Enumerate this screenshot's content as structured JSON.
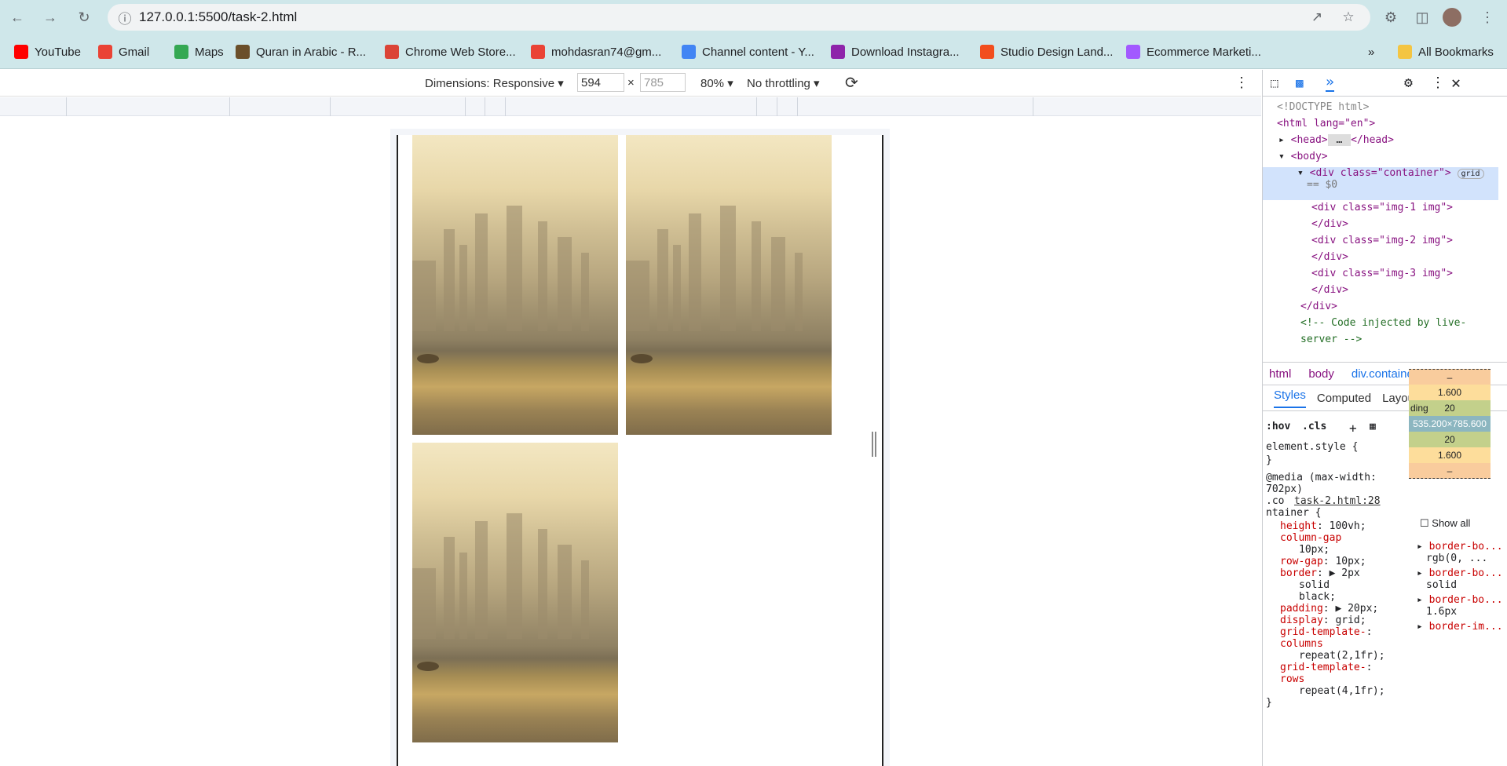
{
  "browser": {
    "url": "127.0.0.1:5500/task-2.html"
  },
  "bookmarks": [
    {
      "label": "YouTube",
      "icon": "youtube-icon",
      "color": "#ff0000"
    },
    {
      "label": "Gmail",
      "icon": "gmail-icon",
      "color": "#ea4335"
    },
    {
      "label": "Maps",
      "icon": "maps-icon",
      "color": "#34a853"
    },
    {
      "label": "Quran in Arabic - R...",
      "icon": "quran-icon",
      "color": "#6b4f2a"
    },
    {
      "label": "Chrome Web Store...",
      "icon": "chrome-store-icon",
      "color": "#db4437"
    },
    {
      "label": "mohdasran74@gm...",
      "icon": "gmail-icon",
      "color": "#ea4335"
    },
    {
      "label": "Channel content - Y...",
      "icon": "google-icon",
      "color": "#4285f4"
    },
    {
      "label": "Download Instagra...",
      "icon": "download-icon",
      "color": "#8e24aa"
    },
    {
      "label": "Studio Design Land...",
      "icon": "figma-icon",
      "color": "#f24e1e"
    },
    {
      "label": "Ecommerce Marketi...",
      "icon": "figma-icon",
      "color": "#a259ff"
    }
  ],
  "all_bookmarks": "All Bookmarks",
  "more_bookmarks": "»",
  "device_toolbar": {
    "dimensions_label": "Dimensions: Responsive",
    "width": "594",
    "times": "×",
    "height": "785",
    "zoom": "80%",
    "throttling": "No throttling"
  },
  "elements": {
    "doctype": "<!DOCTYPE html>",
    "html_open": "<html lang=\"en\">",
    "head": "<head>",
    "head_close": "</head>",
    "body": "<body>",
    "container": "<div class=\"container\">",
    "grid_badge": "grid",
    "dollar_zero": "== $0",
    "img1": "<div class=\"img-1 img\">",
    "img2": "<div class=\"img-2 img\">",
    "img3": "<div class=\"img-3 img\">",
    "div_close": "</div>",
    "comment1": "<!-- Code injected by live-",
    "comment2": "server -->"
  },
  "breadcrumbs": [
    "html",
    "body",
    "div.container"
  ],
  "styles_tabs": [
    "Styles",
    "Computed",
    "Layout",
    "»"
  ],
  "styles_toolbar": {
    "hov": ":hov",
    "cls": ".cls"
  },
  "styles": {
    "element_style": "element.style {",
    "close_brace": "}",
    "media": "@media (max-width:",
    "media2": "702px)",
    "selector_a": ".co",
    "source": "task-2.html:28",
    "selector_b": "ntainer {",
    "rules": [
      [
        "height",
        "100vh;"
      ],
      [
        "column-gap",
        ""
      ],
      [
        "",
        "10px;"
      ],
      [
        "row-gap",
        "10px;"
      ],
      [
        "border",
        "▶ 2px"
      ],
      [
        "",
        "solid"
      ],
      [
        "",
        "black;"
      ],
      [
        "padding",
        "▶ 20px;"
      ],
      [
        "display",
        "grid;"
      ],
      [
        "grid-template-",
        ""
      ],
      [
        "columns",
        ""
      ],
      [
        "",
        "repeat(2,1fr);"
      ],
      [
        "grid-template-",
        ""
      ],
      [
        "rows",
        ""
      ],
      [
        "",
        "repeat(4,1fr);"
      ]
    ]
  },
  "box_model": {
    "margin": "–",
    "border_top": "1.600",
    "padding_label": "ding",
    "padding": "20",
    "content": "535.200×785.600",
    "padding_bottom": "20",
    "border_bottom": "1.600",
    "margin_bottom": "–"
  },
  "computed": {
    "show_all": "Show all",
    "items": [
      [
        "border-bo...",
        "rgb(0, ..."
      ],
      [
        "border-bo...",
        "solid"
      ],
      [
        "border-bo...",
        "1.6px"
      ],
      [
        "border-im...",
        ""
      ]
    ]
  }
}
